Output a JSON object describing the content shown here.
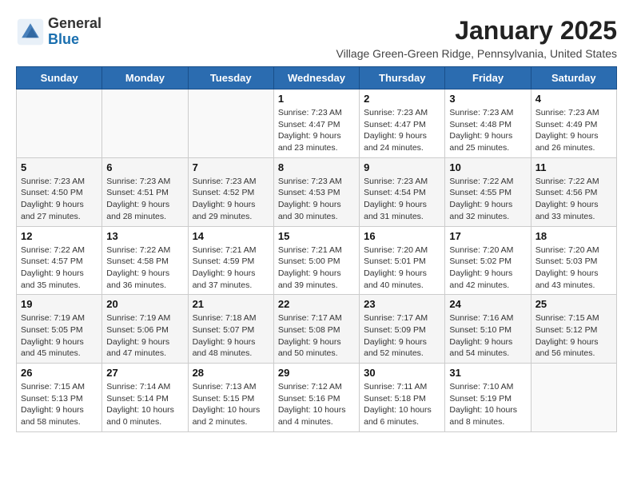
{
  "header": {
    "logo_general": "General",
    "logo_blue": "Blue",
    "month_year": "January 2025",
    "location": "Village Green-Green Ridge, Pennsylvania, United States"
  },
  "days_of_week": [
    "Sunday",
    "Monday",
    "Tuesday",
    "Wednesday",
    "Thursday",
    "Friday",
    "Saturday"
  ],
  "weeks": [
    [
      {
        "day": "",
        "info": ""
      },
      {
        "day": "",
        "info": ""
      },
      {
        "day": "",
        "info": ""
      },
      {
        "day": "1",
        "info": "Sunrise: 7:23 AM\nSunset: 4:47 PM\nDaylight: 9 hours\nand 23 minutes."
      },
      {
        "day": "2",
        "info": "Sunrise: 7:23 AM\nSunset: 4:47 PM\nDaylight: 9 hours\nand 24 minutes."
      },
      {
        "day": "3",
        "info": "Sunrise: 7:23 AM\nSunset: 4:48 PM\nDaylight: 9 hours\nand 25 minutes."
      },
      {
        "day": "4",
        "info": "Sunrise: 7:23 AM\nSunset: 4:49 PM\nDaylight: 9 hours\nand 26 minutes."
      }
    ],
    [
      {
        "day": "5",
        "info": "Sunrise: 7:23 AM\nSunset: 4:50 PM\nDaylight: 9 hours\nand 27 minutes."
      },
      {
        "day": "6",
        "info": "Sunrise: 7:23 AM\nSunset: 4:51 PM\nDaylight: 9 hours\nand 28 minutes."
      },
      {
        "day": "7",
        "info": "Sunrise: 7:23 AM\nSunset: 4:52 PM\nDaylight: 9 hours\nand 29 minutes."
      },
      {
        "day": "8",
        "info": "Sunrise: 7:23 AM\nSunset: 4:53 PM\nDaylight: 9 hours\nand 30 minutes."
      },
      {
        "day": "9",
        "info": "Sunrise: 7:23 AM\nSunset: 4:54 PM\nDaylight: 9 hours\nand 31 minutes."
      },
      {
        "day": "10",
        "info": "Sunrise: 7:22 AM\nSunset: 4:55 PM\nDaylight: 9 hours\nand 32 minutes."
      },
      {
        "day": "11",
        "info": "Sunrise: 7:22 AM\nSunset: 4:56 PM\nDaylight: 9 hours\nand 33 minutes."
      }
    ],
    [
      {
        "day": "12",
        "info": "Sunrise: 7:22 AM\nSunset: 4:57 PM\nDaylight: 9 hours\nand 35 minutes."
      },
      {
        "day": "13",
        "info": "Sunrise: 7:22 AM\nSunset: 4:58 PM\nDaylight: 9 hours\nand 36 minutes."
      },
      {
        "day": "14",
        "info": "Sunrise: 7:21 AM\nSunset: 4:59 PM\nDaylight: 9 hours\nand 37 minutes."
      },
      {
        "day": "15",
        "info": "Sunrise: 7:21 AM\nSunset: 5:00 PM\nDaylight: 9 hours\nand 39 minutes."
      },
      {
        "day": "16",
        "info": "Sunrise: 7:20 AM\nSunset: 5:01 PM\nDaylight: 9 hours\nand 40 minutes."
      },
      {
        "day": "17",
        "info": "Sunrise: 7:20 AM\nSunset: 5:02 PM\nDaylight: 9 hours\nand 42 minutes."
      },
      {
        "day": "18",
        "info": "Sunrise: 7:20 AM\nSunset: 5:03 PM\nDaylight: 9 hours\nand 43 minutes."
      }
    ],
    [
      {
        "day": "19",
        "info": "Sunrise: 7:19 AM\nSunset: 5:05 PM\nDaylight: 9 hours\nand 45 minutes."
      },
      {
        "day": "20",
        "info": "Sunrise: 7:19 AM\nSunset: 5:06 PM\nDaylight: 9 hours\nand 47 minutes."
      },
      {
        "day": "21",
        "info": "Sunrise: 7:18 AM\nSunset: 5:07 PM\nDaylight: 9 hours\nand 48 minutes."
      },
      {
        "day": "22",
        "info": "Sunrise: 7:17 AM\nSunset: 5:08 PM\nDaylight: 9 hours\nand 50 minutes."
      },
      {
        "day": "23",
        "info": "Sunrise: 7:17 AM\nSunset: 5:09 PM\nDaylight: 9 hours\nand 52 minutes."
      },
      {
        "day": "24",
        "info": "Sunrise: 7:16 AM\nSunset: 5:10 PM\nDaylight: 9 hours\nand 54 minutes."
      },
      {
        "day": "25",
        "info": "Sunrise: 7:15 AM\nSunset: 5:12 PM\nDaylight: 9 hours\nand 56 minutes."
      }
    ],
    [
      {
        "day": "26",
        "info": "Sunrise: 7:15 AM\nSunset: 5:13 PM\nDaylight: 9 hours\nand 58 minutes."
      },
      {
        "day": "27",
        "info": "Sunrise: 7:14 AM\nSunset: 5:14 PM\nDaylight: 10 hours\nand 0 minutes."
      },
      {
        "day": "28",
        "info": "Sunrise: 7:13 AM\nSunset: 5:15 PM\nDaylight: 10 hours\nand 2 minutes."
      },
      {
        "day": "29",
        "info": "Sunrise: 7:12 AM\nSunset: 5:16 PM\nDaylight: 10 hours\nand 4 minutes."
      },
      {
        "day": "30",
        "info": "Sunrise: 7:11 AM\nSunset: 5:18 PM\nDaylight: 10 hours\nand 6 minutes."
      },
      {
        "day": "31",
        "info": "Sunrise: 7:10 AM\nSunset: 5:19 PM\nDaylight: 10 hours\nand 8 minutes."
      },
      {
        "day": "",
        "info": ""
      }
    ]
  ]
}
